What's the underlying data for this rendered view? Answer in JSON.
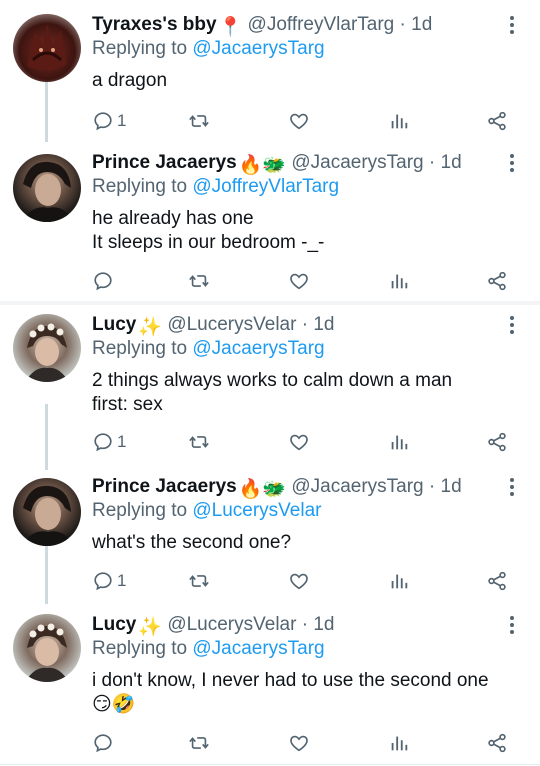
{
  "colors": {
    "accent": "#1d9bf0",
    "secondary_text": "#536471",
    "primary_text": "#0f1419",
    "thread_line": "#cfd9de"
  },
  "tweets": [
    {
      "name": "Tyraxes's bby",
      "name_emoji": "📍",
      "handle": "@JoffreyVlarTarg",
      "time": "1d",
      "replying_prefix": "Replying to",
      "replying_to": "@JacaerysTarg",
      "text": "a dragon",
      "reply_count": "1",
      "avatar_icon": "dragon-avatar"
    },
    {
      "name": "Prince Jacaerys",
      "name_emoji": "🔥🐲",
      "handle": "@JacaerysTarg",
      "time": "1d",
      "replying_prefix": "Replying to",
      "replying_to": "@JoffreyVlarTarg",
      "text": "he already has one\nIt sleeps in our bedroom -_-",
      "reply_count": "",
      "avatar_icon": "dark-haired-man-avatar"
    },
    {
      "name": "Lucy",
      "name_emoji": "✨",
      "handle": "@LucerysVelar",
      "time": "1d",
      "replying_prefix": "Replying to",
      "replying_to": "@JacaerysTarg",
      "text": "2 things always works to calm down a man\nfirst: sex",
      "reply_count": "1",
      "avatar_icon": "flower-crown-avatar"
    },
    {
      "name": "Prince Jacaerys",
      "name_emoji": "🔥🐲",
      "handle": "@JacaerysTarg",
      "time": "1d",
      "replying_prefix": "Replying to",
      "replying_to": "@LucerysVelar",
      "text": "what's the second one?",
      "reply_count": "1",
      "avatar_icon": "dark-haired-man-avatar"
    },
    {
      "name": "Lucy",
      "name_emoji": "✨",
      "handle": "@LucerysVelar",
      "time": "1d",
      "replying_prefix": "Replying to",
      "replying_to": "@JacaerysTarg",
      "text": "i don't know, I never had to use the second one\n😏🤣",
      "reply_count": "",
      "avatar_icon": "flower-crown-avatar"
    }
  ],
  "action_icons": [
    "reply-icon",
    "retweet-icon",
    "like-icon",
    "analytics-icon",
    "share-icon"
  ],
  "dot_separator": "·"
}
